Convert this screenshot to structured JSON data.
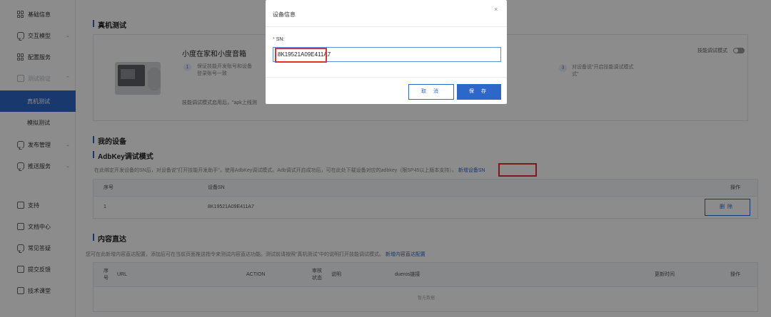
{
  "sidebar": {
    "items": [
      {
        "label": "基础信息",
        "icon": "grid-icon"
      },
      {
        "label": "交互模型",
        "icon": "chat-icon",
        "chevron": "⌄"
      },
      {
        "label": "配置服务",
        "icon": "grid-icon"
      },
      {
        "label": "测试验证",
        "icon": "monitor-icon",
        "chevron": "⌃"
      },
      {
        "label": "真机测试"
      },
      {
        "label": "模拟测试"
      },
      {
        "label": "发布管理",
        "icon": "chat-icon",
        "chevron": "⌄"
      },
      {
        "label": "推送服务",
        "icon": "chat-icon",
        "chevron": "⌄"
      },
      {
        "label": "支持",
        "icon": "doc-icon"
      },
      {
        "label": "文档中心",
        "icon": "doc-icon"
      },
      {
        "label": "常见答疑",
        "icon": "chat-icon"
      },
      {
        "label": "提交反馈",
        "icon": "edit-icon"
      },
      {
        "label": "技术课堂",
        "icon": "video-icon"
      }
    ]
  },
  "device_section": {
    "title": "真机测试",
    "device_name": "小度在家和小度音箱",
    "step1_num": "1",
    "step1_text_line1": "保证技能开发账号和设备",
    "step1_text_line2": "登录账号一致",
    "step3_num": "3",
    "step3_text_line1": "对设备说\"开启技能调试模式",
    "step3_text_line2": "式\"",
    "hint": "技能调试模式启用后，\"apk上线测",
    "toggle_label": "技能调试模式"
  },
  "my_devices": {
    "title": "我的设备",
    "adb_title": "AdbKey调试模式",
    "description": "在此绑定开发设备的SN后，对设备说\"打开技能开发助手\"，使用AdbKey调试模式。Adb调试开启成功后，可在此处下载设备对应的adbkey（限SP45以上版本支持）。",
    "add_link": "新增设备SN",
    "columns": [
      "序号",
      "设备SN",
      "操作"
    ],
    "rows": [
      {
        "index": "1",
        "sn": "8K19521A09E411A7",
        "action": "删除"
      }
    ]
  },
  "content_direct": {
    "title": "内容直达",
    "description": "您可在此新增内容直达配置，添加后可在当前页面推送指令来测试内容直达功能。测试前请按照\"真机测试\"中的说明打开技能调试模式。",
    "add_link": "新增内容直达配置",
    "columns": [
      "序号",
      "URL",
      "ACTION",
      "审核状态",
      "说明",
      "dueros链接",
      "更新时间",
      "操作"
    ],
    "col_seq_line1": "序",
    "col_seq_line2": "号",
    "col_status_line1": "审核",
    "col_status_line2": "状态",
    "empty_text": "暂无数据"
  },
  "modal": {
    "title": "设备信息",
    "close_glyph": "×",
    "field_label": "SN",
    "field_label_suffix": ":",
    "required_mark": "*",
    "sn_value": "8K19521A09E411A7",
    "cancel_label": "取 消",
    "save_label": "保 存"
  },
  "colors": {
    "accent": "#2d67c9",
    "highlight_box": "#e0302f"
  }
}
